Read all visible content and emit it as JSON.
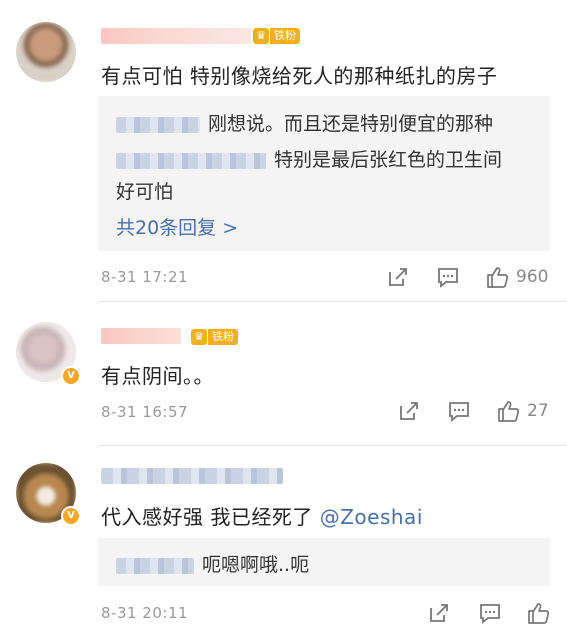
{
  "badge_label": "铁粉",
  "comments": [
    {
      "text": "有点可怕 特别像烧给死人的那种纸扎的房子",
      "replies": [
        {
          "text": "刚想说。而且还是特别便宜的那种"
        },
        {
          "text": "特别是最后张红色的卫生间"
        },
        {
          "text": "好可怕"
        }
      ],
      "more_replies": "共20条回复 >",
      "time": "8-31 17:21",
      "likes": "960"
    },
    {
      "text": "有点阴间。。",
      "time": "8-31 16:57",
      "likes": "27"
    },
    {
      "text": "代入感好强 我已经死了 ",
      "mention": "@Zoeshai",
      "replies": [
        {
          "text": "呃嗯啊哦..呃"
        }
      ],
      "time": "8-31 20:11",
      "likes": ""
    }
  ],
  "colors": {
    "link": "#4a6fa5",
    "badge": "#f2b01e",
    "verified": "#f5a623"
  }
}
